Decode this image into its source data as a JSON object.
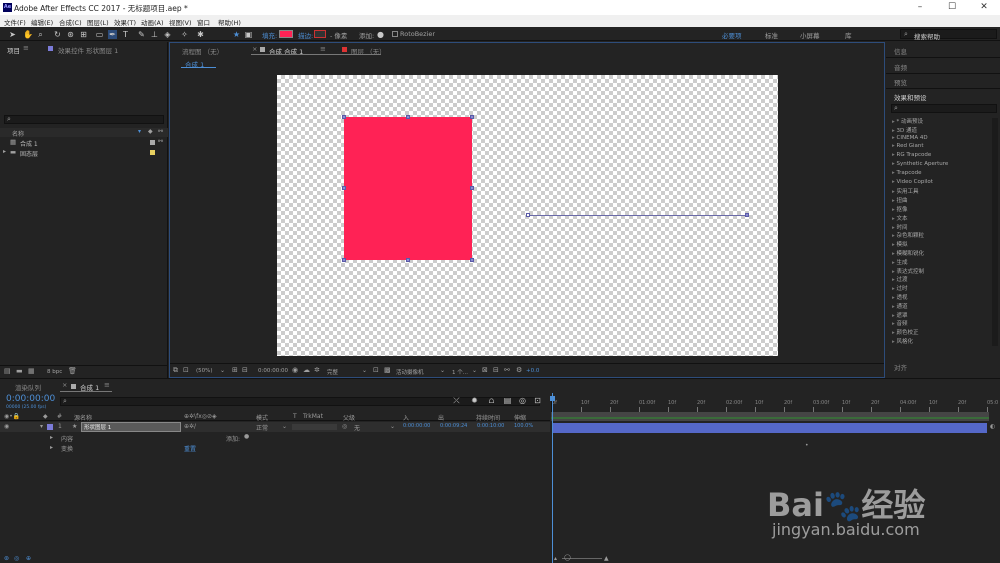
{
  "window": {
    "title": "Adobe After Effects CC 2017 - 无标题项目.aep *"
  },
  "menu": [
    "文件(F)",
    "编辑(E)",
    "合成(C)",
    "图层(L)",
    "效果(T)",
    "动画(A)",
    "视图(V)",
    "窗口",
    "帮助(H)"
  ],
  "toolbar": {
    "fill_label": "填充:",
    "stroke_label": "描边:",
    "stroke_size": "- 像素",
    "add_label": "添加:",
    "rotobezier_label": "RotoBezier",
    "fill_color": "#ff2255",
    "workspaces": [
      "必要项",
      "标准",
      "小屏幕",
      "库"
    ],
    "search_help": "搜索帮助"
  },
  "project_panel": {
    "tab_project": "项目",
    "tab_effect_controls": "效果控件 形状图层 1",
    "col_name": "名称",
    "items": [
      {
        "name": "合成 1",
        "icon": "composition-icon"
      },
      {
        "name": "固态层",
        "icon": "folder-icon"
      }
    ],
    "bpc": "8 bpc"
  },
  "viewer": {
    "tab_flow": "流程图 （无）",
    "tab_comp": "合成 合成 1",
    "tab_layer": "图层 （无）",
    "comp_label": "合成 1",
    "zoom": "(50%)",
    "timecode": "0:00:00:00",
    "quality": "完整",
    "camera": "活动摄像机",
    "views": "1 个...",
    "exposure": "+0.0",
    "shape_color": "#ff2255"
  },
  "right_panel": {
    "info": "信息",
    "audio": "音频",
    "preview": "预览",
    "effects_presets": "效果和预设",
    "effects": [
      "* 动画预设",
      "3D 通道",
      "CINEMA 4D",
      "Red Giant",
      "RG Trapcode",
      "Synthetic Aperture",
      "Trapcode",
      "Video Copilot",
      "实用工具",
      "扭曲",
      "抠像",
      "文本",
      "时间",
      "杂色和颗粒",
      "模拟",
      "模糊和锐化",
      "生成",
      "表达式控制",
      "过渡",
      "过时",
      "透视",
      "通道",
      "遮罩",
      "音频",
      "颜色校正",
      "风格化"
    ],
    "align": "对齐"
  },
  "timeline": {
    "tab_render": "渲染队列",
    "tab_comp": "合成 1",
    "timecode": "0:00:00:00",
    "frame_info": "00000 (25.00 fps)",
    "headers": {
      "num": "#",
      "source_name": "源名称",
      "mode": "模式",
      "t": "T",
      "trkmat": "TrkMat",
      "parent": "父级",
      "in": "入",
      "out": "出",
      "duration": "持续时间",
      "stretch": "伸缩"
    },
    "layer": {
      "num": "1",
      "name": "形状图层 1",
      "mode": "正常",
      "parent": "无",
      "in": "0:00:00:00",
      "out": "0:00:09:24",
      "duration": "0:00:10:00",
      "stretch": "100.0%"
    },
    "sub_contents": "内容",
    "sub_add": "添加:",
    "sub_transform": "变换",
    "sub_reset": "重置",
    "ruler": [
      "0f",
      "10f",
      "20f",
      "01:00f",
      "10f",
      "20f",
      "02:00f",
      "10f",
      "20f",
      "03:00f",
      "10f",
      "20f",
      "04:00f",
      "10f",
      "20f",
      "05:0"
    ]
  },
  "watermark": {
    "brand": "Bai",
    "brand2": "经验",
    "url": "jingyan.baidu.com"
  }
}
